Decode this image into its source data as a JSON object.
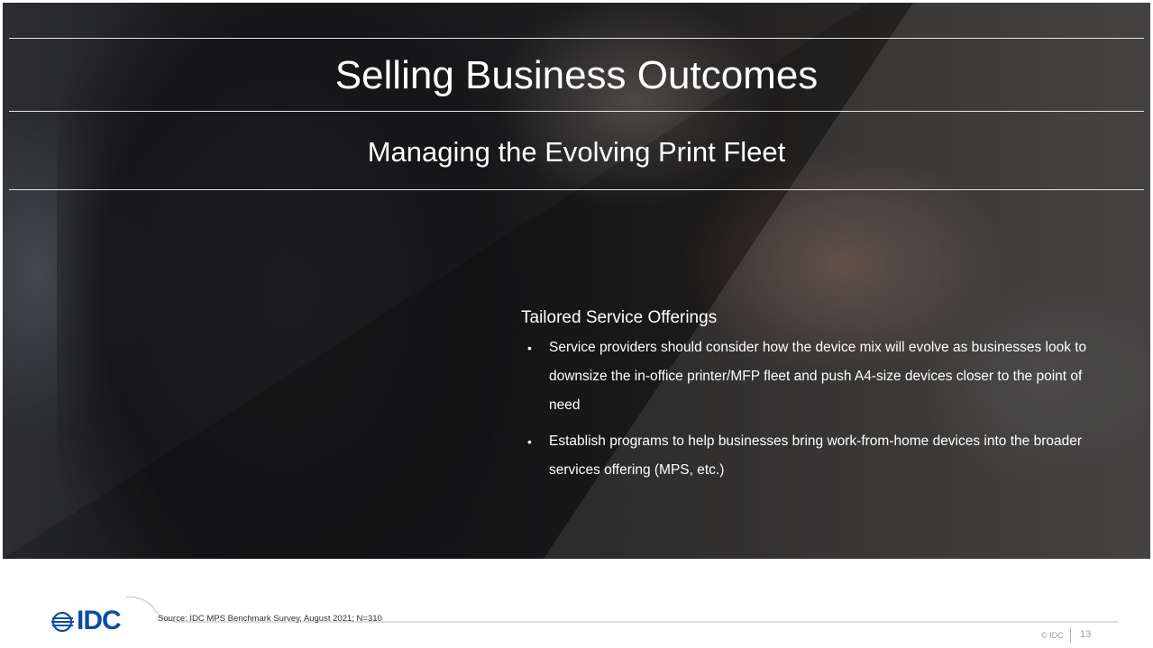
{
  "slide": {
    "title": "Selling Business Outcomes",
    "subtitle": "Managing the Evolving Print Fleet"
  },
  "content": {
    "heading": "Tailored Service Offerings",
    "bullets": [
      "Service providers should consider how the device mix will evolve as businesses look to downsize the in-office printer/MFP fleet and push A4-size devices closer to the point of need",
      "Establish programs to help businesses bring work-from-home devices into the broader services offering (MPS, etc.)"
    ],
    "bullet_symbol": "•"
  },
  "footer": {
    "logo_text": "IDC",
    "source": "Source: IDC MPS Benchmark Survey, August 2021; N=310",
    "copyright": "© IDC",
    "page_number": "13"
  },
  "colors": {
    "brand_blue": "#0b4ea2",
    "text_light": "#ffffff"
  }
}
